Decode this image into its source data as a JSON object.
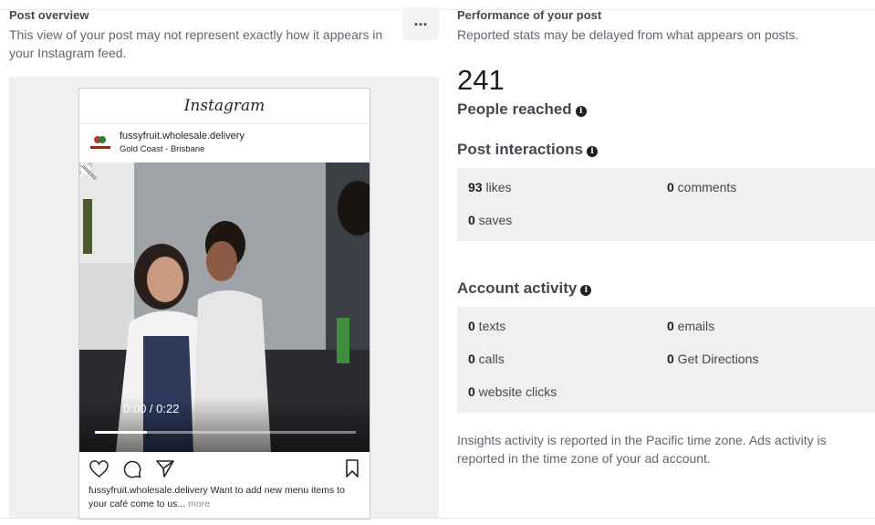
{
  "overview": {
    "title": "Post overview",
    "subtitle": "This view of your post may not represent exactly how it appears in your Instagram feed.",
    "more_button": "..."
  },
  "post": {
    "logo": "Instagram",
    "account_name": "fussyfruit.wholesale.delivery",
    "location": "Gold Coast - Brisbane",
    "video_time": "0:00 / 0:22",
    "video_progress": 0.2,
    "caption_user": "fussyfruit.wholesale.delivery",
    "caption_text": " Want to add new menu items to your café come to us...",
    "caption_more": " more"
  },
  "performance": {
    "title": "Performance of your post",
    "subtitle": "Reported stats may be delayed from what appears on posts.",
    "people_reached": "241",
    "people_reached_label": "People reached"
  },
  "interactions": {
    "title": "Post interactions",
    "items": [
      {
        "value": "93",
        "label": " likes"
      },
      {
        "value": "0",
        "label": " comments"
      },
      {
        "value": "0",
        "label": " saves"
      }
    ]
  },
  "activity": {
    "title": "Account activity",
    "items": [
      {
        "value": "0",
        "label": " texts"
      },
      {
        "value": "0",
        "label": " emails"
      },
      {
        "value": "0",
        "label": " calls"
      },
      {
        "value": "0",
        "label": " Get Directions"
      },
      {
        "value": "0",
        "label": " website clicks"
      }
    ]
  },
  "footnote": "Insights activity is reported in the Pacific time zone. Ads activity is reported in the time zone of your ad account.",
  "icons": {
    "info": "info-icon",
    "play": "play-icon",
    "mute": "mute-icon",
    "fullscreen": "fullscreen-icon",
    "options": "kebab-icon",
    "like": "heart-icon",
    "comment": "comment-icon",
    "share": "share-icon",
    "save": "bookmark-icon"
  }
}
